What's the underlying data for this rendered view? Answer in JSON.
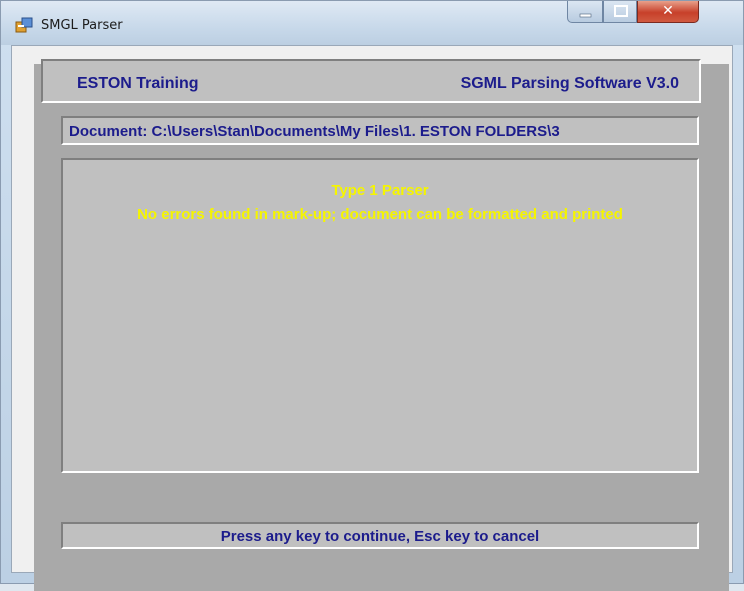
{
  "window": {
    "title": "SMGL Parser",
    "app_icon": "app-icon",
    "controls": {
      "minimize_icon": "minimize-icon",
      "maximize_icon": "maximize-icon",
      "close_icon": "close-icon"
    }
  },
  "header": {
    "left": "ESTON Training",
    "right": "SGML Parsing Software V3.0"
  },
  "document": {
    "path": "Document: C:\\Users\\Stan\\Documents\\My Files\\1. ESTON FOLDERS\\3"
  },
  "output": {
    "line1": "Type 1 Parser",
    "line2": "No errors found in mark-up; document can be formatted and printed"
  },
  "status": {
    "text": "Press any key to continue, Esc key to cancel"
  },
  "colors": {
    "panel_bg": "#a9a9a9",
    "inset_bg": "#c0c0c0",
    "label_text": "#1c1c8c",
    "output_text": "#f5f500",
    "close_button": "#c7402a"
  }
}
